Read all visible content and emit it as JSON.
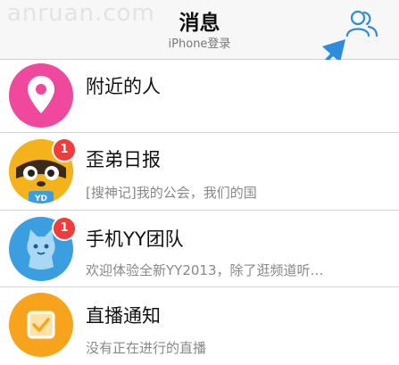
{
  "watermark": "anruan.com",
  "nav": {
    "title": "消息",
    "subtitle": "iPhone登录",
    "contacts_icon": "contacts-group-icon"
  },
  "colors": {
    "nearby": "#f0489c",
    "report": "#f6b21a",
    "team": "#3b9ee0",
    "broadcast": "#f7a31c",
    "badge": "#f23c3c",
    "arrow": "#2e8ce0"
  },
  "messages": [
    {
      "title": "附近的人",
      "icon": "location-pin-icon"
    },
    {
      "title": "歪弟日报",
      "preview": "[搜神记]我的公会，我们的国",
      "badge": "1",
      "icon": "raccoon-mascot-avatar"
    },
    {
      "title": "手机YY团队",
      "preview": "欢迎体验全新YY2013，除了逛频道听…",
      "badge": "1",
      "icon": "cat-mascot-avatar"
    },
    {
      "title": "直播通知",
      "preview": "没有正在进行的直播",
      "icon": "checkbox-icon"
    }
  ]
}
